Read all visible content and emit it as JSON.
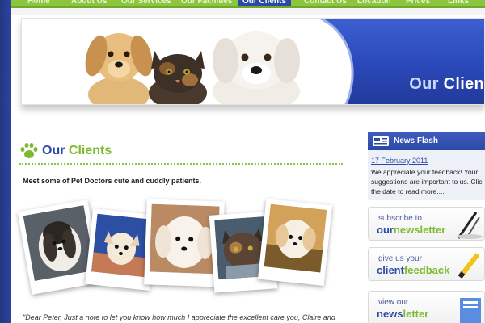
{
  "nav": {
    "items": [
      {
        "label": "Home"
      },
      {
        "label": "About Us"
      },
      {
        "label": "Our Services"
      },
      {
        "label": "Our Facilities"
      },
      {
        "label": "Our Clients"
      },
      {
        "label": "Contact Us"
      },
      {
        "label": "Location"
      },
      {
        "label": "Prices"
      },
      {
        "label": "Links"
      }
    ],
    "active_index": 4
  },
  "banner": {
    "title_part1": "Our",
    "title_part2": "Clien"
  },
  "page": {
    "heading_part1": "Our",
    "heading_part2": "Clients",
    "intro": "Meet some of Pet Doctors cute and cuddly patients.",
    "quote": "\"Dear Peter, Just a note to let you know how much I appreciate the excellent care you, Claire and"
  },
  "news_flash": {
    "title": "News Flash",
    "date": "17 February 2011",
    "body_lines": [
      "We appreciate your feedback! Your",
      "suggestions are important to us. Clic",
      "the date to read more...."
    ]
  },
  "promos": [
    {
      "line1": "subscribe to",
      "line2a": "our",
      "line2b": "newsletter",
      "icon": "pen-icon"
    },
    {
      "line1": "give us your",
      "line2a": "client",
      "line2b": "feedback",
      "icon": "pencil-icon"
    },
    {
      "line1": "view our",
      "line2a": "news",
      "line2b": "letter",
      "icon": "newspaper-icon"
    }
  ],
  "colors": {
    "brand_blue": "#2b4aa6",
    "brand_green": "#7cbb2e",
    "nav_green": "#8cc63f"
  }
}
